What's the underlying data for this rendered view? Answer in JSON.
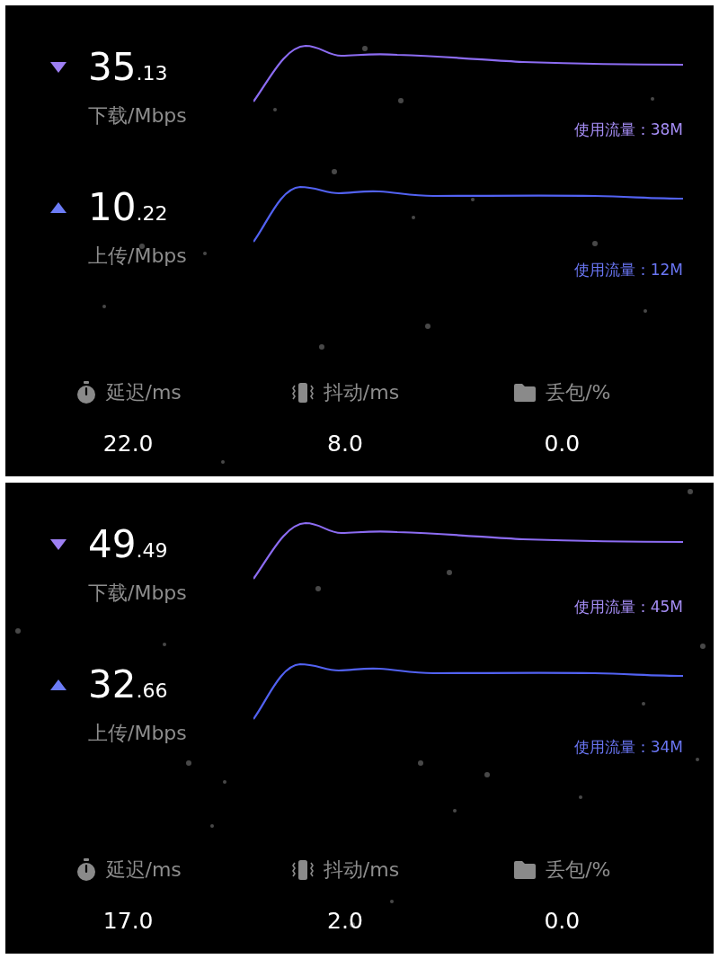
{
  "panels": [
    {
      "rows": [
        {
          "kind": "download",
          "speed_int": "35",
          "speed_dec": ".13",
          "label": "下载/Mbps",
          "usage": "使用流量：38M"
        },
        {
          "kind": "upload",
          "speed_int": "10",
          "speed_dec": ".22",
          "label": "上传/Mbps",
          "usage": "使用流量：12M"
        }
      ],
      "stats": [
        {
          "kind": "latency",
          "label": "延迟/ms",
          "value": "22.0"
        },
        {
          "kind": "jitter",
          "label": "抖动/ms",
          "value": "8.0"
        },
        {
          "kind": "loss",
          "label": "丢包/%",
          "value": "0.0"
        }
      ]
    },
    {
      "rows": [
        {
          "kind": "download",
          "speed_int": "49",
          "speed_dec": ".49",
          "label": "下载/Mbps",
          "usage": "使用流量：45M"
        },
        {
          "kind": "upload",
          "speed_int": "32",
          "speed_dec": ".66",
          "label": "上传/Mbps",
          "usage": "使用流量：34M"
        }
      ],
      "stats": [
        {
          "kind": "latency",
          "label": "延迟/ms",
          "value": "17.0"
        },
        {
          "kind": "jitter",
          "label": "抖动/ms",
          "value": "2.0"
        },
        {
          "kind": "loss",
          "label": "丢包/%",
          "value": "0.0"
        }
      ]
    }
  ]
}
